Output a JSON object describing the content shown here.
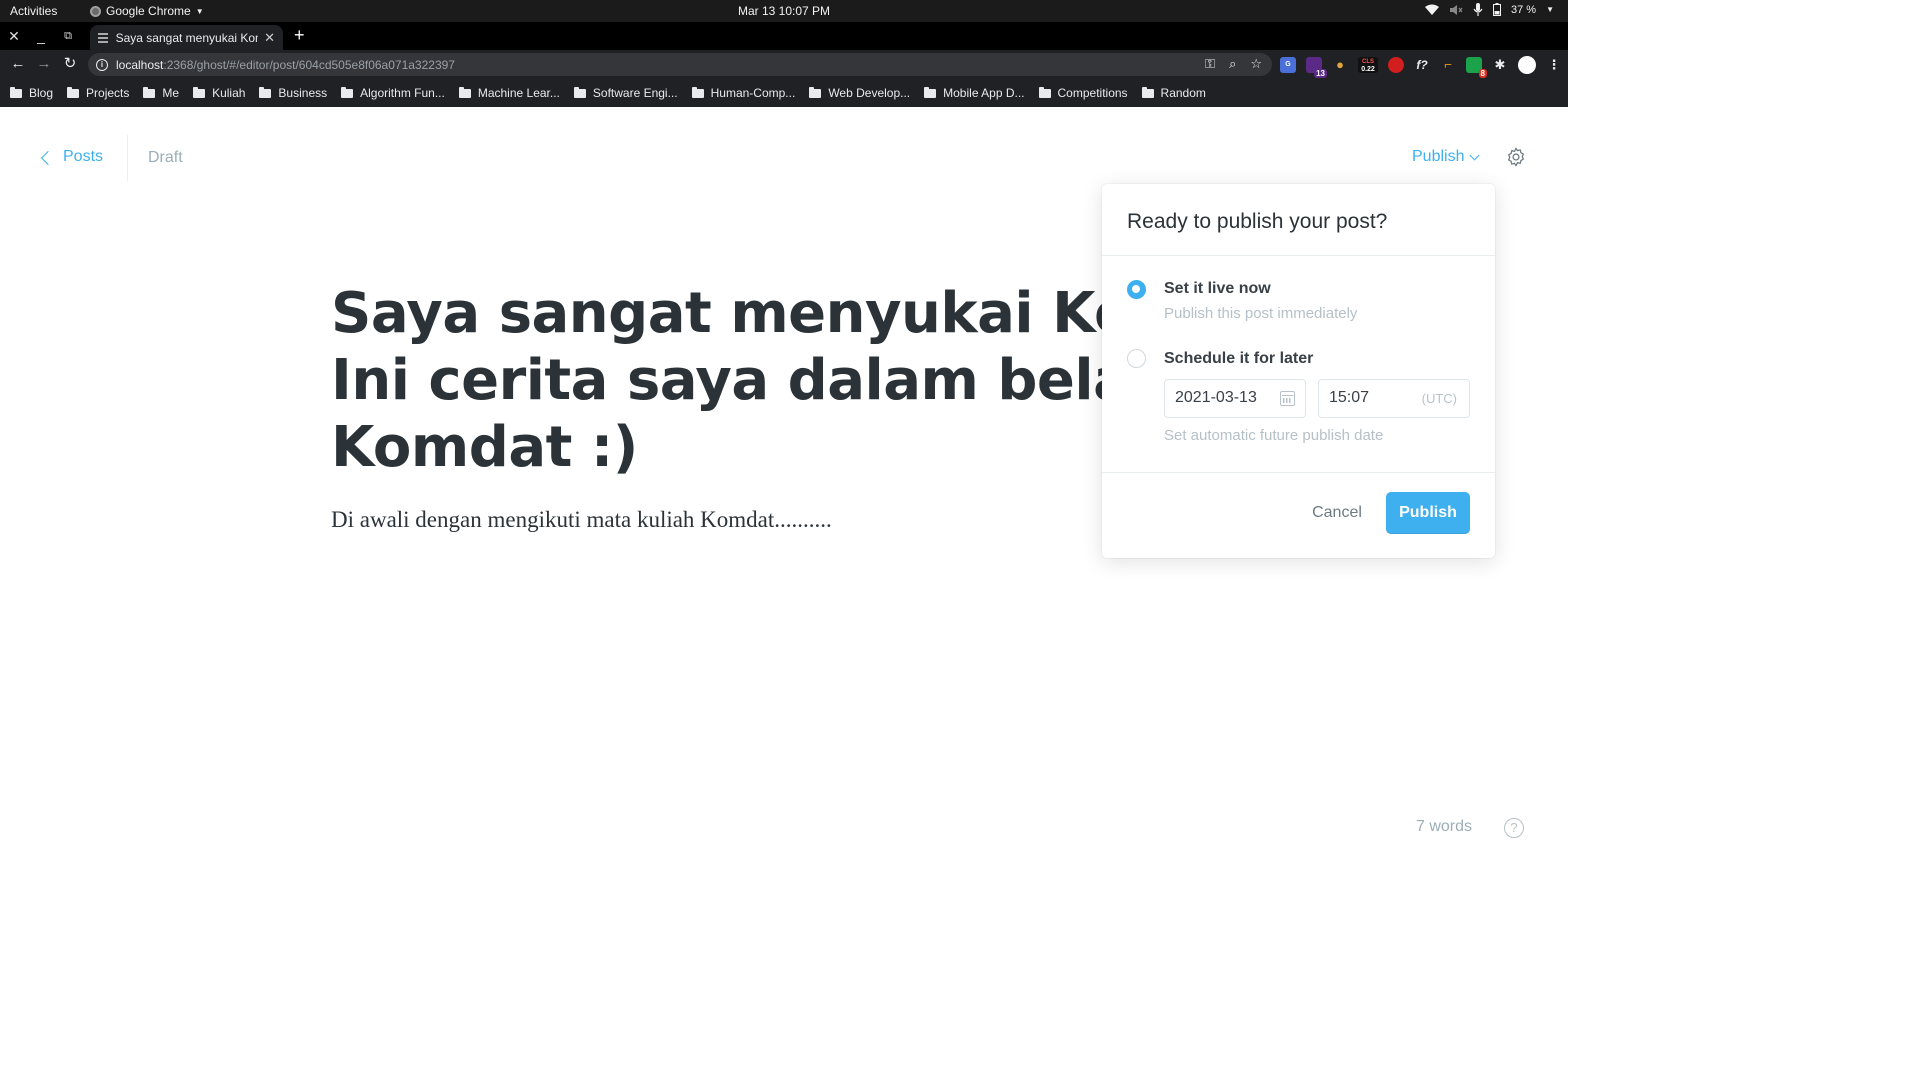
{
  "system_bar": {
    "activities": "Activities",
    "app_name": "Google Chrome",
    "clock": "Mar 13  10:07 PM",
    "battery": "37 %"
  },
  "browser": {
    "tab_title": "Saya sangat menyukai Komdat",
    "url_host": "localhost",
    "url_rest": ":2368/ghost/#/editor/post/604cd505e8f06a071a322397",
    "extension_badges": {
      "ext2": "13",
      "cls_label": "CLS",
      "cls_value": "0.22",
      "ext8": "8"
    },
    "bookmarks": [
      "Blog",
      "Projects",
      "Me",
      "Kuliah",
      "Business",
      "Algorithm Fun...",
      "Machine Lear...",
      "Software Engi...",
      "Human-Comp...",
      "Web Develop...",
      "Mobile App D...",
      "Competitions",
      "Random"
    ]
  },
  "editor": {
    "back_label": "Posts",
    "status": "Draft",
    "publish_menu_label": "Publish",
    "title_lines": [
      "Saya sangat menyukai Komda",
      "Ini cerita saya dalam belajar",
      "Komdat :)"
    ],
    "body": "Di awali dengan mengikuti mata kuliah Komdat..........",
    "word_count": "7 words",
    "help_label": "?"
  },
  "publish_popover": {
    "title": "Ready to publish your post?",
    "option_now": {
      "label": "Set it live now",
      "sub": "Publish this post immediately",
      "selected": true
    },
    "option_later": {
      "label": "Schedule it for later",
      "sub": "Set automatic future publish date",
      "selected": false
    },
    "date_value": "2021-03-13",
    "time_value": "15:07",
    "timezone": "(UTC)",
    "cancel_label": "Cancel",
    "publish_label": "Publish"
  },
  "colors": {
    "accent": "#3eb0ef",
    "title_text": "#2b3338",
    "muted_text": "#9baeb8"
  }
}
